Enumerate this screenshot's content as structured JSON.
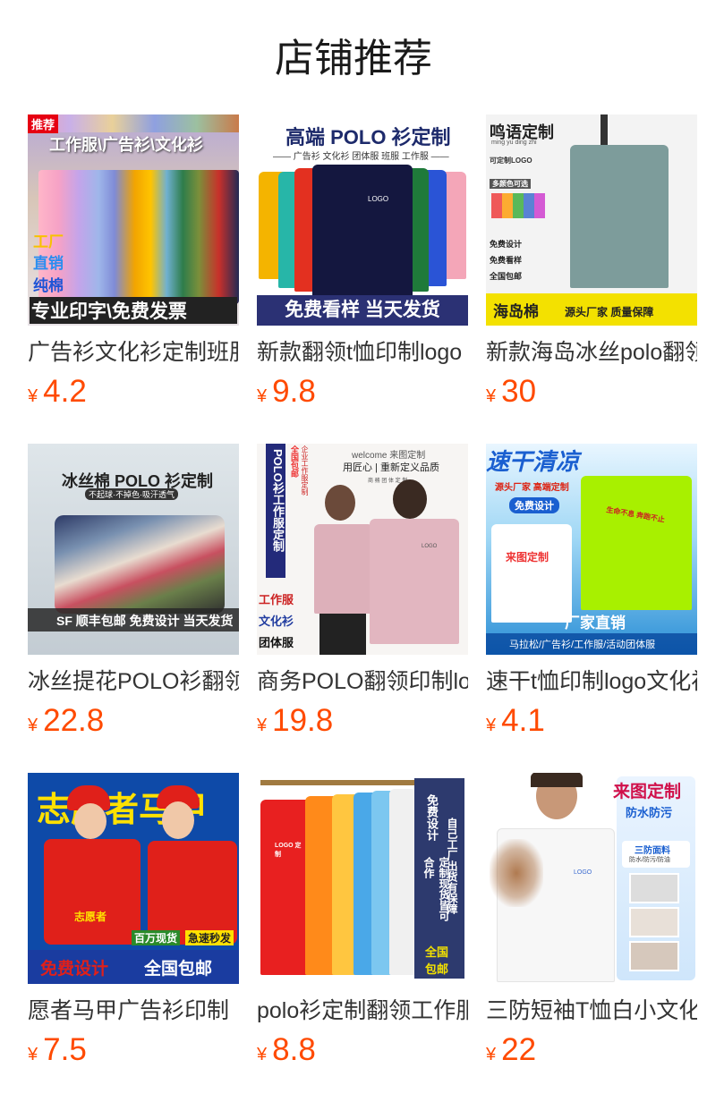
{
  "page": {
    "title": "店铺推荐"
  },
  "products": [
    {
      "name": "广告衫文化衫定制班服",
      "currency": "¥",
      "price": "4.2",
      "image": {
        "texts": [
          "推荐",
          "工作服\\广告衫\\文化衫",
          "工厂",
          "直销",
          "纯棉",
          "专业印字\\免费发票"
        ]
      }
    },
    {
      "name": "新款翻领t恤印制logo",
      "currency": "¥",
      "price": "9.8",
      "image": {
        "texts": [
          "高端 POLO 衫定制",
          "—— 广告衫 文化衫 团体服 班服 工作服 ——",
          "LOGO",
          "免费看样  当天发货"
        ]
      }
    },
    {
      "name": "新款海岛冰丝polo翻领",
      "currency": "¥",
      "price": "30",
      "image": {
        "texts": [
          "鸣语定制",
          "ming yu ding zhi",
          "可定制LOGO",
          "多颜色可选",
          "免费设计",
          "免费看样",
          "全国包邮",
          "海岛棉",
          "源头厂家  质量保障"
        ]
      }
    },
    {
      "name": "冰丝提花POLO衫翻领",
      "currency": "¥",
      "price": "22.8",
      "image": {
        "texts": [
          "冰丝棉 POLO 衫定制",
          "不起球·不掉色·吸汗透气",
          "SF 顺丰包邮  免费设计  当天发货"
        ]
      }
    },
    {
      "name": "商务POLO翻领印制logo",
      "currency": "¥",
      "price": "19.8",
      "image": {
        "texts": [
          "POLO衫工作服定制",
          "全国包邮",
          "企业工作服定制",
          "welcome 来图定制",
          "用匠心 | 重新定义品质",
          "商 務 团 体 定 制",
          "工作服",
          "文化衫",
          "团体服",
          "LOGO"
        ]
      }
    },
    {
      "name": "速干t恤印制logo文化衫",
      "currency": "¥",
      "price": "4.1",
      "image": {
        "texts": [
          "速干清凉",
          "源头厂家  高端定制",
          "免费设计",
          "来图定制",
          "生命不息 奔跑不止",
          "厂家直销",
          "马拉松/广告衫/工作服/活动团体服"
        ]
      }
    },
    {
      "name": "愿者马甲广告衫印制",
      "currency": "¥",
      "price": "7.5",
      "image": {
        "texts": [
          "志愿者马甲",
          "志愿者",
          "百万现货",
          "急速秒发",
          "免费设计",
          "全国包邮"
        ]
      }
    },
    {
      "name": "polo衫定制翻领工作服",
      "currency": "¥",
      "price": "8.8",
      "image": {
        "texts": [
          "免费设计",
          "定制现货皆可合作",
          "自己工厂出货有保障",
          "全国包邮",
          "LOGO 定制"
        ]
      }
    },
    {
      "name": "三防短袖T恤白小文化衫",
      "currency": "¥",
      "price": "22",
      "image": {
        "texts": [
          "来图定制",
          "防水防污",
          "三防面料",
          "防水/防污/防油",
          "LOGO"
        ]
      }
    }
  ]
}
